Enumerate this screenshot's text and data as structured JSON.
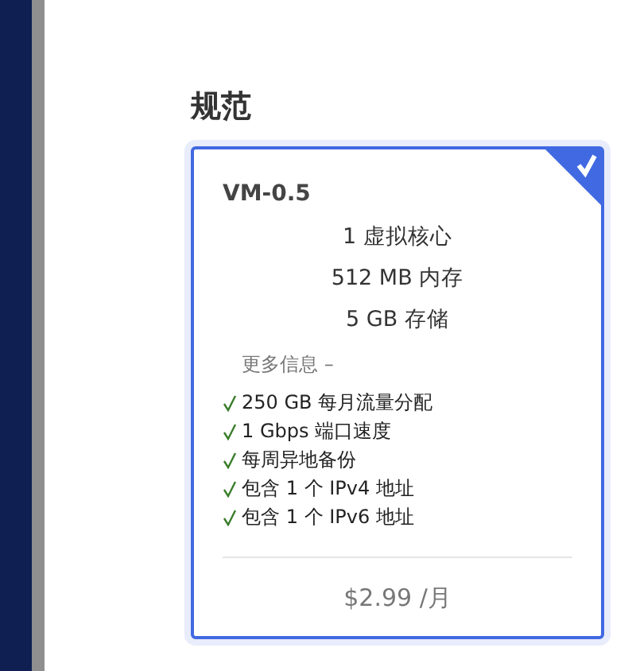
{
  "section_title": "规范",
  "plans": [
    {
      "name": "VM-0.5",
      "selected": true,
      "specs": [
        "1 虚拟核心",
        "512 MB 内存",
        "5 GB 存储"
      ],
      "more_info": "更多信息 –",
      "features": [
        "250 GB 每月流量分配",
        "1 Gbps 端口速度",
        "每周异地备份",
        "包含 1 个 IPv4 地址",
        "包含 1 个 IPv6 地址"
      ],
      "price": "$2.99 /月"
    }
  ]
}
